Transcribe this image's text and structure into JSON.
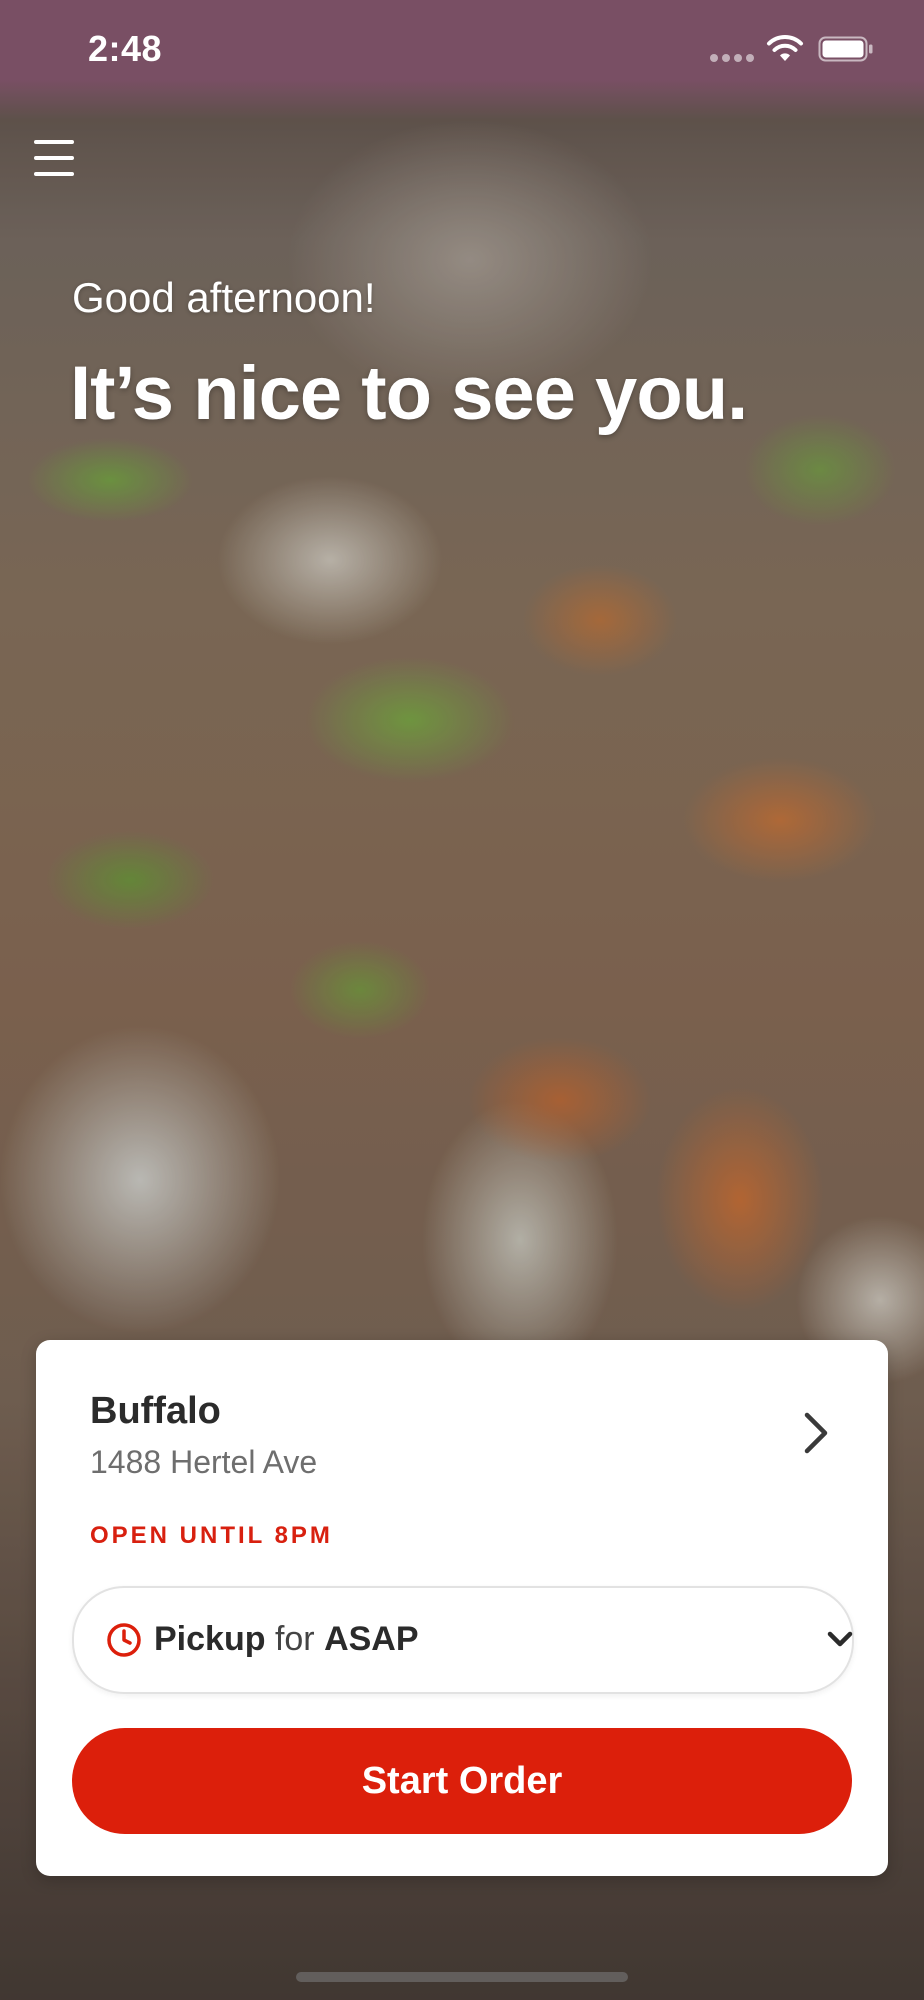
{
  "status_bar": {
    "time": "2:48"
  },
  "hero": {
    "greeting": "Good afternoon!",
    "headline": "It’s nice to see you."
  },
  "location": {
    "name": "Buffalo",
    "address": "1488 Hertel Ave",
    "hours_status": "OPEN UNTIL 8PM"
  },
  "order_mode": {
    "mode": "Pickup",
    "connector": "for",
    "time": "ASAP"
  },
  "actions": {
    "start_order_label": "Start Order"
  },
  "colors": {
    "accent": "#dc1f0b",
    "text_primary": "#2b2b2b",
    "text_secondary": "#6e6e6e"
  },
  "icons": {
    "menu": "hamburger-icon",
    "location_chevron": "chevron-right-icon",
    "clock": "clock-icon",
    "dropdown": "chevron-down-icon",
    "wifi": "wifi-icon",
    "battery": "battery-icon"
  }
}
